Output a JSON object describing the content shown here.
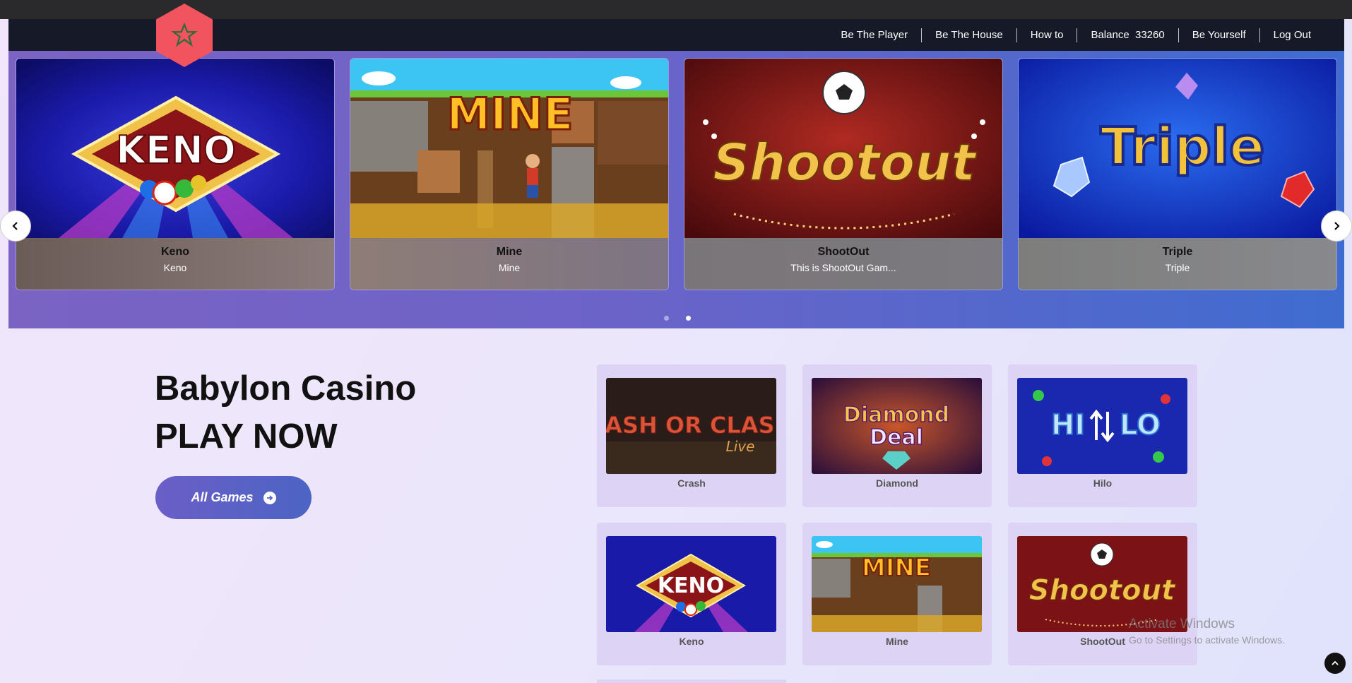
{
  "nav": {
    "items": [
      {
        "label": "Be The Player"
      },
      {
        "label": "Be The House"
      },
      {
        "label": "How to"
      },
      {
        "label": "Balance  33260"
      },
      {
        "label": "Be Yourself"
      },
      {
        "label": "Log Out"
      }
    ],
    "logo_icon": "star-icon"
  },
  "carousel": {
    "slides": [
      {
        "title": "Keno",
        "desc": "Keno",
        "art_text": "KENO"
      },
      {
        "title": "Mine",
        "desc": "Mine",
        "art_text": "MINE"
      },
      {
        "title": "ShootOut",
        "desc": "This is ShootOut Gam...",
        "art_text": "Shootout"
      },
      {
        "title": "Triple",
        "desc": "Triple",
        "art_text": "Triple"
      }
    ],
    "prev_icon": "chevron-left-icon",
    "next_icon": "chevron-right-icon",
    "active_dot": 2
  },
  "hero": {
    "line1": "Babylon Casino",
    "line2": "PLAY NOW",
    "button_label": "All Games",
    "button_icon": "arrow-right-circle-icon"
  },
  "games": [
    {
      "label": "Crash",
      "art_text": "CASH OR CLASH",
      "art_sub": "Live"
    },
    {
      "label": "Diamond",
      "art_text": "Diamond",
      "art_sub": "Deal"
    },
    {
      "label": "Hilo",
      "art_text": "HI",
      "art_sub": "LO"
    },
    {
      "label": "Keno",
      "art_text": "KENO",
      "art_sub": ""
    },
    {
      "label": "Mine",
      "art_text": "MINE",
      "art_sub": ""
    },
    {
      "label": "ShootOut",
      "art_text": "Shootout",
      "art_sub": ""
    }
  ],
  "watermark": {
    "line1": "Activate Windows",
    "line2": "Go to Settings to activate Windows."
  },
  "colors": {
    "logo": "#f1535f",
    "navbar": "#161a28",
    "button_gradient_start": "#6b5ec7",
    "button_gradient_end": "#4c64c4"
  }
}
